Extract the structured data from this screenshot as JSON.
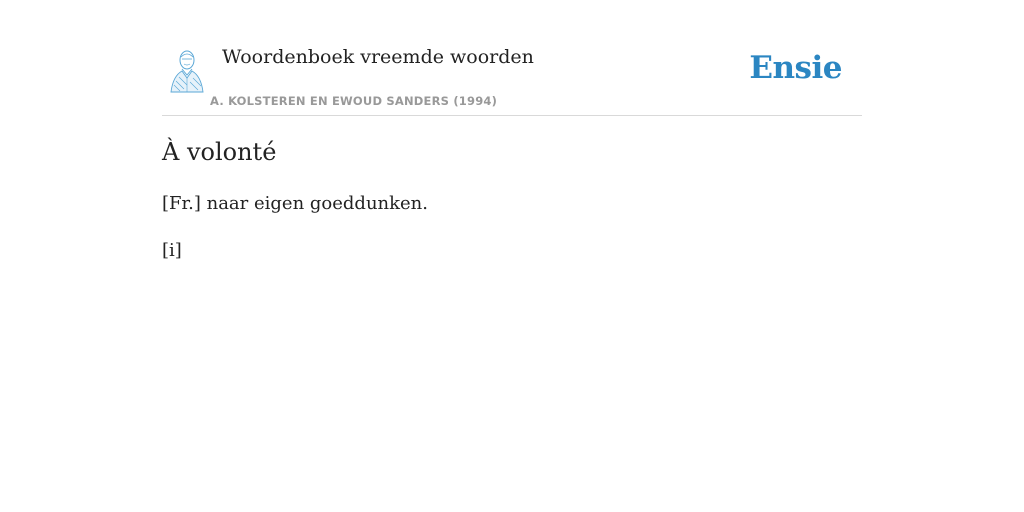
{
  "header": {
    "book_title": "Woordenboek vreemde woorden",
    "authors": "A. KOLSTEREN EN EWOUD SANDERS (1994)",
    "brand": "Ensie",
    "portrait_icon": "author-portrait-icon"
  },
  "entry": {
    "title": "À volonté",
    "definition": "[Fr.] naar eigen goeddunken.",
    "marker": "[i]"
  },
  "colors": {
    "brand": "#2b86c2",
    "portrait": "#5aa7d6",
    "text": "#222222",
    "muted": "#999999",
    "divider": "#d9d9d9"
  }
}
